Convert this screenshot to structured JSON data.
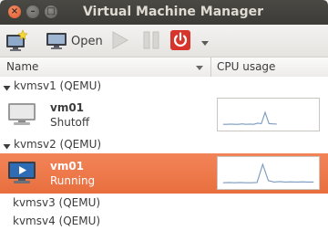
{
  "window": {
    "title": "Virtual Machine Manager",
    "close_glyph": "×",
    "minimize_glyph": "–",
    "maximize_glyph": "□"
  },
  "toolbar": {
    "new_icon": "monitor-star-icon",
    "open_label": "Open",
    "open_icon": "monitor-icon",
    "run_icon": "play-icon",
    "pause_icon": "pause-icon",
    "shutdown_icon": "power-icon",
    "menu_icon": "chevron-down-icon"
  },
  "columns": {
    "name": "Name",
    "cpu": "CPU usage"
  },
  "connections": [
    {
      "label": "kvmsv1 (QEMU)",
      "expanded": true,
      "vms": [
        {
          "name": "vm01",
          "status": "Shutoff",
          "selected": false,
          "cpu_trace": [
            0.05,
            0.05,
            0.06,
            0.05,
            0.05,
            0.07,
            0.05,
            0.06,
            0.05,
            0.1,
            0.08,
            0.6,
            0.08,
            0.07,
            0.06
          ]
        }
      ]
    },
    {
      "label": "kvmsv2 (QEMU)",
      "expanded": true,
      "vms": [
        {
          "name": "vm01",
          "status": "Running",
          "selected": true,
          "cpu_trace": [
            0.05,
            0.06,
            0.05,
            0.06,
            0.05,
            0.05,
            0.06,
            0.9,
            0.15,
            0.08,
            0.1,
            0.08,
            0.09,
            0.08,
            0.09,
            0.08,
            0.08
          ]
        }
      ]
    },
    {
      "label": "kvmsv3 (QEMU)",
      "expanded": false,
      "vms": []
    },
    {
      "label": "kvmsv4 (QEMU)",
      "expanded": false,
      "vms": []
    }
  ],
  "colors": {
    "accent": "#f07746",
    "sparkline": "#7b9bc0",
    "power": "#d7342b"
  }
}
